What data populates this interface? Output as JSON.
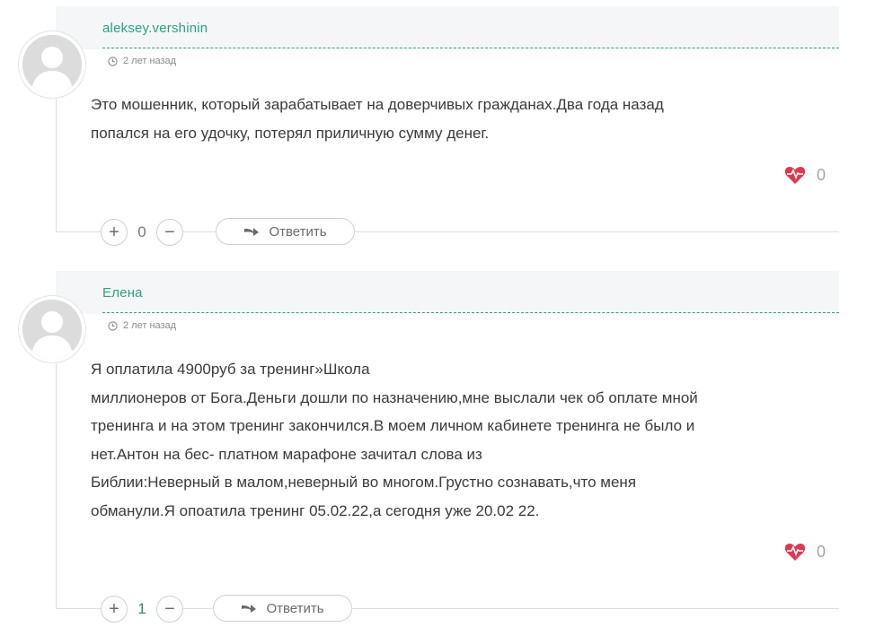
{
  "comments": [
    {
      "author": "aleksey.vershinin",
      "time": "2 лет назад",
      "lines": [
        "Это мошенник, который зарабатывает на доверчивых гражданах.Два года назад",
        "попался на его удочку, потерял приличную сумму денег."
      ],
      "likes": "0",
      "votes": "0",
      "reply_label": "Ответить"
    },
    {
      "author": "Елена",
      "time": "2 лет назад",
      "lines": [
        "Я оплатила 4900руб за тренинг»Школа",
        "миллионеров от Бога.Деньги дошли по назначению,мне выслали чек об оплате мной",
        "тренинга и на этом тренинг закончился.В моем личном кабинете тренинга не было и",
        "нет.Антон на бес- платном марафоне зачитал слова из",
        "Библии:Неверный в малом,неверный во многом.Грустно сознавать,что меня",
        "обманули.Я опоатила тренинг 05.02.22,а сегодня уже 20.02 22."
      ],
      "likes": "0",
      "votes": "1",
      "reply_label": "Ответить"
    }
  ],
  "icons": {
    "clock": "clock-icon",
    "heart": "heart-pulse-icon",
    "reply": "reply-arrow-icon",
    "plus": "+",
    "minus": "−"
  },
  "colors": {
    "accent": "#2aa27f",
    "heart": "#e0384f"
  }
}
